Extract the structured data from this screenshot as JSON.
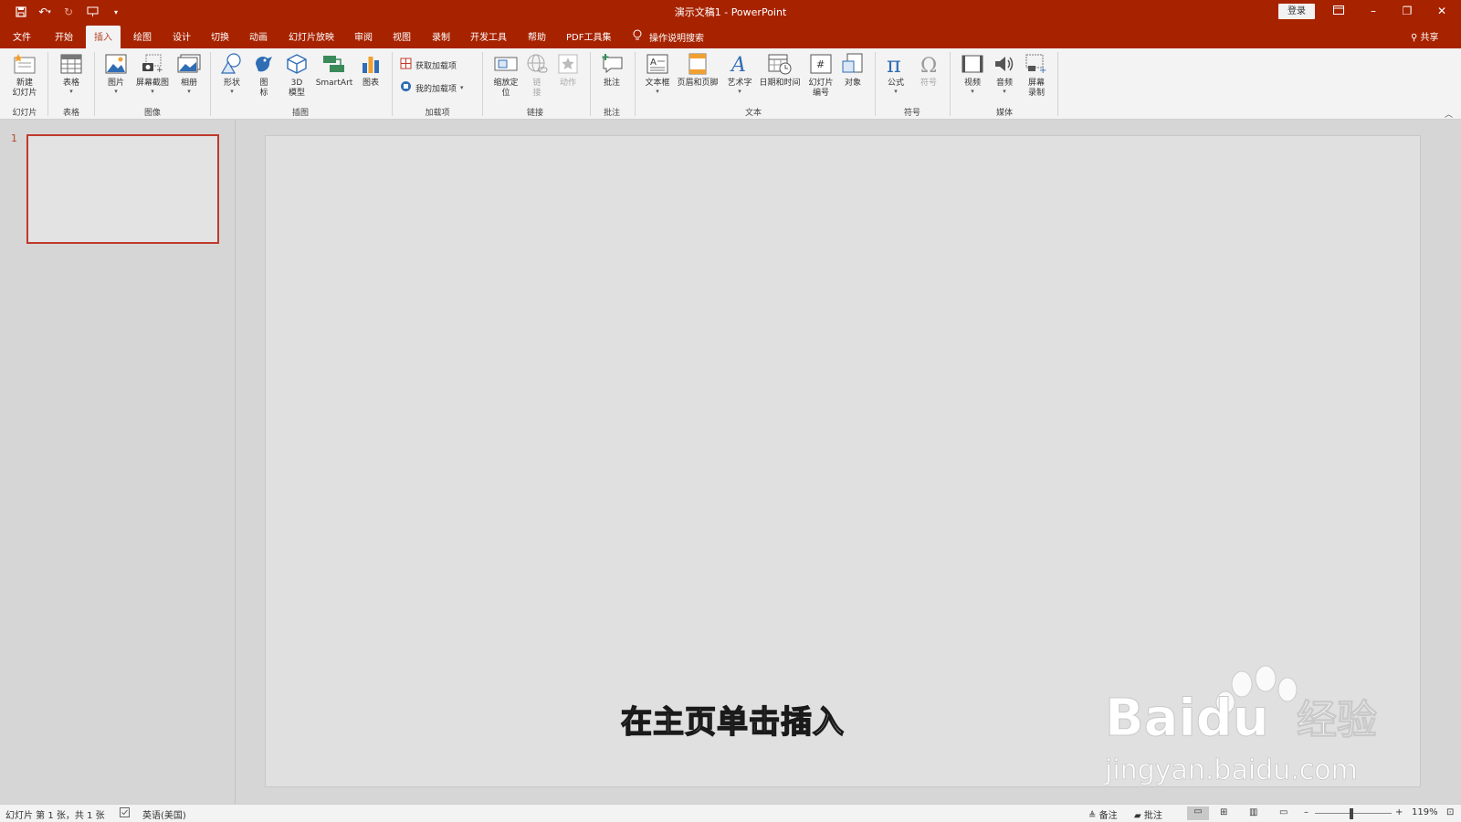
{
  "window": {
    "title": "演示文稿1  -  PowerPoint",
    "login_label": "登录"
  },
  "tabs": [
    {
      "label": "文件"
    },
    {
      "label": "开始"
    },
    {
      "label": "插入"
    },
    {
      "label": "绘图"
    },
    {
      "label": "设计"
    },
    {
      "label": "切换"
    },
    {
      "label": "动画"
    },
    {
      "label": "幻灯片放映"
    },
    {
      "label": "审阅"
    },
    {
      "label": "视图"
    },
    {
      "label": "录制"
    },
    {
      "label": "开发工具"
    },
    {
      "label": "帮助"
    },
    {
      "label": "PDF工具集"
    }
  ],
  "active_tab": "插入",
  "tell_me": "操作说明搜索",
  "share": "共享",
  "ribbon": {
    "new_slide": "新建\n幻灯片",
    "table": "表格",
    "picture": "图片",
    "screenshot": "屏幕截图",
    "album": "相册",
    "shapes": "形状",
    "icons": "图\n标",
    "model3d": "3D\n模型",
    "smartart": "SmartArt",
    "chart": "图表",
    "get_addins": "获取加载项",
    "my_addins": "我的加载项",
    "zoom": "缩放定\n位",
    "link": "链\n接",
    "action": "动作",
    "comment": "批注",
    "textbox": "文本框",
    "header_footer": "页眉和页脚",
    "wordart": "艺术字",
    "datetime": "日期和时间",
    "slide_number": "幻灯片\n编号",
    "object": "对象",
    "equation": "公式",
    "symbol": "符号",
    "video": "视频",
    "audio": "音频",
    "screen_recording": "屏幕\n录制",
    "groups": {
      "slides": "幻灯片",
      "tables": "表格",
      "images": "图像",
      "illustrations": "插图",
      "addins": "加载项",
      "links": "链接",
      "comments": "批注",
      "text": "文本",
      "symbols": "符号",
      "media": "媒体"
    }
  },
  "thumbnails": [
    {
      "number": "1"
    }
  ],
  "caption": "在主页单击插入",
  "watermark": {
    "brand": "Baidu",
    "brand_cn": "经验",
    "url": "jingyan.baidu.com"
  },
  "status": {
    "slide_info": "幻灯片 第 1 张，共 1 张",
    "language": "英语(美国)",
    "notes": "备注",
    "comments": "批注",
    "zoom": "119%"
  },
  "colors": {
    "accent": "#a72300",
    "ribbon_bg": "#f3f3f3",
    "pane_bg": "#d6d6d6"
  }
}
